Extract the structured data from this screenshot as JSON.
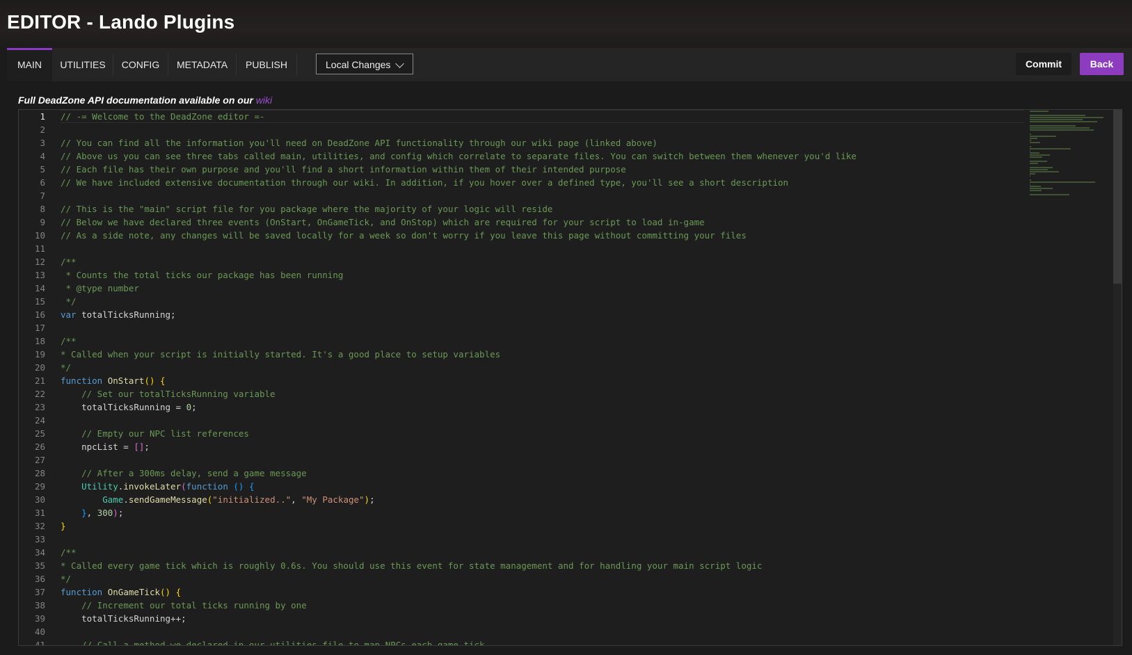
{
  "title": "EDITOR - Lando Plugins",
  "tabs": [
    "MAIN",
    "UTILITIES",
    "CONFIG",
    "METADATA",
    "PUBLISH"
  ],
  "branch_select": "Local Changes",
  "buttons": {
    "commit": "Commit",
    "back": "Back"
  },
  "note": {
    "text": "Full DeadZone API documentation available on our",
    "link": "wiki"
  },
  "colors": {
    "accent": "#8d3cbf",
    "comment": "#6a9955",
    "keyword": "#569cd6"
  },
  "current_line": 1,
  "code_lines": [
    [
      [
        "c",
        "// -= Welcome to the DeadZone editor =-"
      ]
    ],
    [],
    [
      [
        "c",
        "// You can find all the information you'll need on DeadZone API functionality through our wiki page (linked above)"
      ]
    ],
    [
      [
        "c",
        "// Above us you can see three tabs called main, utilities, and config which correlate to separate files. You can switch between them whenever you'd like"
      ]
    ],
    [
      [
        "c",
        "// Each file has their own purpose and you'll find a short information within them of their intended purpose"
      ]
    ],
    [
      [
        "c",
        "// We have included extensive documentation through our wiki. In addition, if you hover over a defined type, you'll see a short description"
      ]
    ],
    [],
    [
      [
        "c",
        "// This is the \"main\" script file for you package where the majority of your logic will reside"
      ]
    ],
    [
      [
        "c",
        "// Below we have declared three events (OnStart, OnGameTick, and OnStop) which are required for your script to load in-game"
      ]
    ],
    [
      [
        "c",
        "// As a side note, any changes will be saved locally for a week so don't worry if you leave this page without committing your files"
      ]
    ],
    [],
    [
      [
        "c",
        "/**"
      ]
    ],
    [
      [
        "c",
        " * Counts the total ticks our package has been running"
      ]
    ],
    [
      [
        "c",
        " * @type number"
      ]
    ],
    [
      [
        "c",
        " */"
      ]
    ],
    [
      [
        "k",
        "var"
      ],
      [
        "v",
        " totalTicksRunning;"
      ]
    ],
    [],
    [
      [
        "c",
        "/**"
      ]
    ],
    [
      [
        "c",
        "* Called when your script is initially started. It's a good place to setup variables"
      ]
    ],
    [
      [
        "c",
        "*/"
      ]
    ],
    [
      [
        "k",
        "function"
      ],
      [
        "v",
        " "
      ],
      [
        "f",
        "OnStart"
      ],
      [
        "y",
        "()"
      ],
      [
        "v",
        " "
      ],
      [
        "y",
        "{"
      ]
    ],
    [
      [
        "v",
        "    "
      ],
      [
        "c",
        "// Set our totalTicksRunning variable"
      ]
    ],
    [
      [
        "v",
        "    totalTicksRunning = "
      ],
      [
        "n",
        "0"
      ],
      [
        "v",
        ";"
      ]
    ],
    [],
    [
      [
        "v",
        "    "
      ],
      [
        "c",
        "// Empty our NPC list references"
      ]
    ],
    [
      [
        "v",
        "    npcList = "
      ],
      [
        "pk",
        "[]"
      ],
      [
        "v",
        ";"
      ]
    ],
    [],
    [
      [
        "v",
        "    "
      ],
      [
        "c",
        "// After a 300ms delay, send a game message"
      ]
    ],
    [
      [
        "v",
        "    "
      ],
      [
        "cl",
        "Utility"
      ],
      [
        "v",
        "."
      ],
      [
        "f",
        "invokeLater"
      ],
      [
        "pk",
        "("
      ],
      [
        "k",
        "function"
      ],
      [
        "v",
        " "
      ],
      [
        "bl",
        "()"
      ],
      [
        "v",
        " "
      ],
      [
        "bl",
        "{"
      ]
    ],
    [
      [
        "v",
        "        "
      ],
      [
        "cl",
        "Game"
      ],
      [
        "v",
        "."
      ],
      [
        "f",
        "sendGameMessage"
      ],
      [
        "y",
        "("
      ],
      [
        "s",
        "\"initialized..\""
      ],
      [
        "v",
        ", "
      ],
      [
        "s",
        "\"My Package\""
      ],
      [
        "y",
        ")"
      ],
      [
        "v",
        ";"
      ]
    ],
    [
      [
        "v",
        "    "
      ],
      [
        "bl",
        "}"
      ],
      [
        "v",
        ", "
      ],
      [
        "n",
        "300"
      ],
      [
        "pk",
        ")"
      ],
      [
        "v",
        ";"
      ]
    ],
    [
      [
        "y",
        "}"
      ]
    ],
    [],
    [
      [
        "c",
        "/**"
      ]
    ],
    [
      [
        "c",
        "* Called every game tick which is roughly 0.6s. You should use this event for state management and for handling your main script logic"
      ]
    ],
    [
      [
        "c",
        "*/"
      ]
    ],
    [
      [
        "k",
        "function"
      ],
      [
        "v",
        " "
      ],
      [
        "f",
        "OnGameTick"
      ],
      [
        "y",
        "()"
      ],
      [
        "v",
        " "
      ],
      [
        "y",
        "{"
      ]
    ],
    [
      [
        "v",
        "    "
      ],
      [
        "c",
        "// Increment our total ticks running by one"
      ]
    ],
    [
      [
        "v",
        "    totalTicksRunning++;"
      ]
    ],
    [],
    [
      [
        "v",
        "    "
      ],
      [
        "c",
        "// Call a method we declared in our utilities file to map NPCs each game tick"
      ]
    ]
  ]
}
